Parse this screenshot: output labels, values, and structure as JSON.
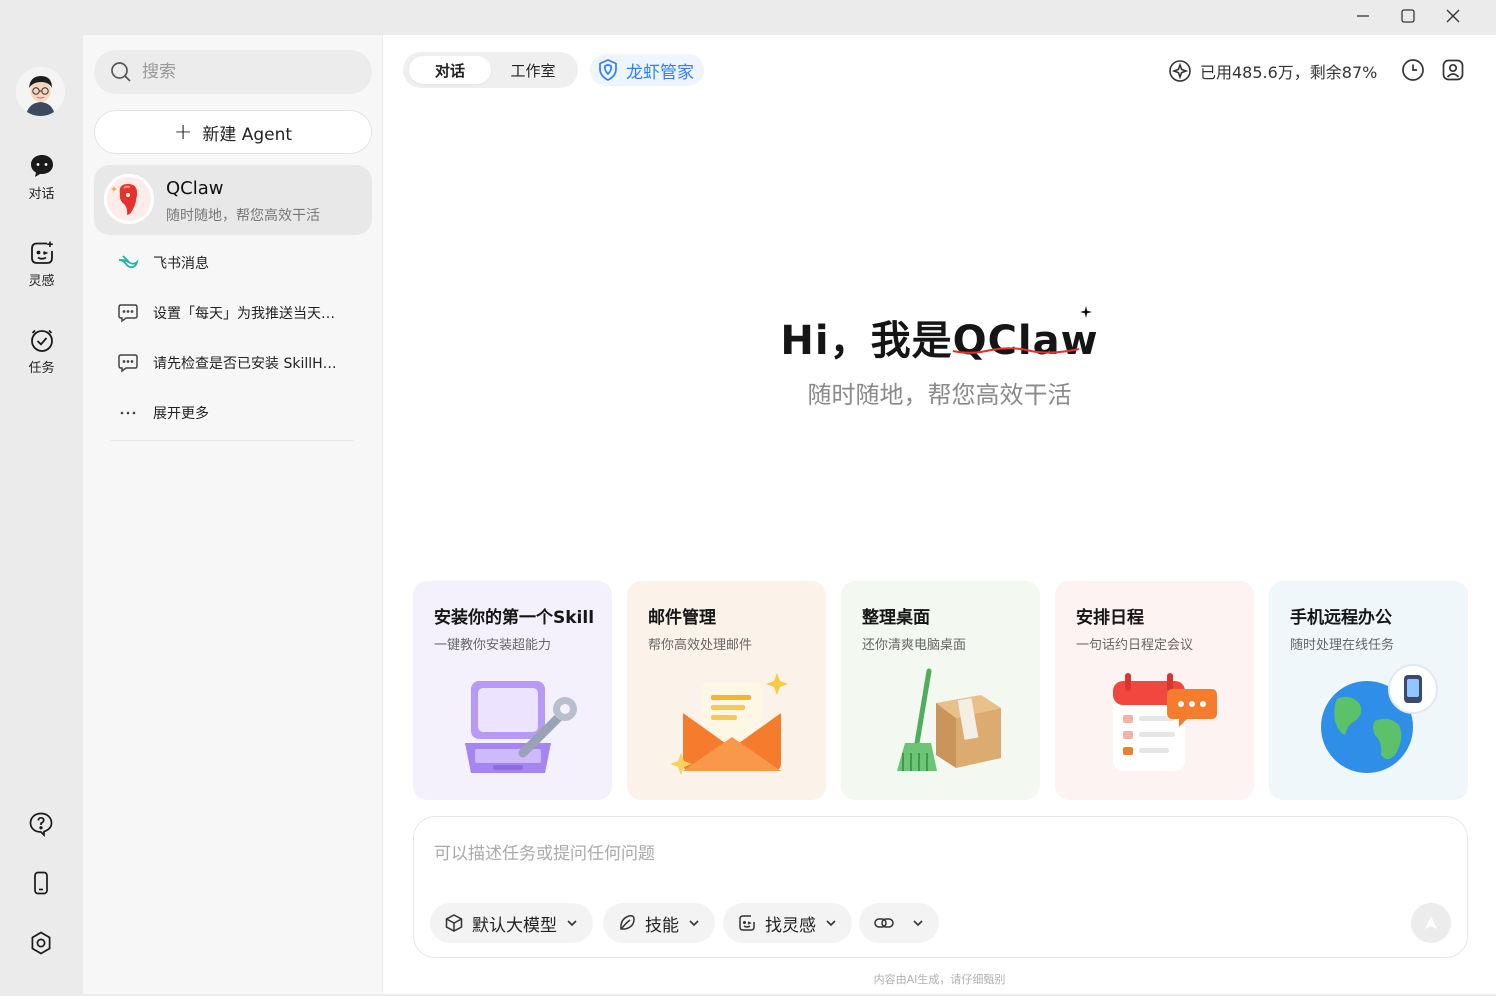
{
  "window": {
    "controls": [
      "minimize",
      "maximize",
      "close"
    ]
  },
  "rail": {
    "items": [
      {
        "label": "对话",
        "icon": "chat-bubble-icon"
      },
      {
        "label": "灵感",
        "icon": "inspiration-icon"
      },
      {
        "label": "任务",
        "icon": "task-check-icon"
      }
    ],
    "bottom_icons": [
      "help-icon",
      "phone-icon",
      "settings-icon"
    ]
  },
  "sidebar": {
    "search_placeholder": "搜索",
    "new_agent_label": "新建 Agent",
    "agent": {
      "name": "QClaw",
      "subtitle": "随时随地，帮您高效干活"
    },
    "chats": [
      {
        "label": "飞书消息",
        "icon": "feishu-icon"
      },
      {
        "label": "设置「每天」为我推送当天…",
        "icon": "chat-icon"
      },
      {
        "label": "请先检查是否已安装 SkillH…",
        "icon": "chat-icon"
      },
      {
        "label": "展开更多",
        "icon": "more-icon"
      }
    ]
  },
  "topbar": {
    "tabs": [
      {
        "label": "对话",
        "active": true
      },
      {
        "label": "工作室",
        "active": false
      }
    ],
    "lobster_label": "龙虾管家",
    "usage_text": "已用485.6万，剩余87%"
  },
  "hero": {
    "title": "Hi，我是QClaw",
    "subtitle": "随时随地，帮您高效干活"
  },
  "cards": [
    {
      "title": "安装你的第一个Skill",
      "subtitle": "一键教你安装超能力",
      "bg": "#f4f1fd",
      "icon": "laptop-wrench-icon"
    },
    {
      "title": "邮件管理",
      "subtitle": "帮你高效处理邮件",
      "bg": "#fbf3ea",
      "icon": "envelope-icon"
    },
    {
      "title": "整理桌面",
      "subtitle": "还你清爽电脑桌面",
      "bg": "#f3f8f1",
      "icon": "broom-box-icon"
    },
    {
      "title": "安排日程",
      "subtitle": "一句话约日程定会议",
      "bg": "#fdf3f2",
      "icon": "calendar-icon"
    },
    {
      "title": "手机远程办公",
      "subtitle": "随时处理在线任务",
      "bg": "#eff7fb",
      "icon": "globe-phone-icon"
    }
  ],
  "composer": {
    "placeholder": "可以描述任务或提问任何问题",
    "model_label": "默认大模型",
    "skill_label": "技能",
    "inspiration_label": "找灵感"
  },
  "disclaimer": "内容由AI生成，请仔细甄别",
  "colors": {
    "accent_blue": "#2f7ef6",
    "brand_red": "#e5322d"
  }
}
